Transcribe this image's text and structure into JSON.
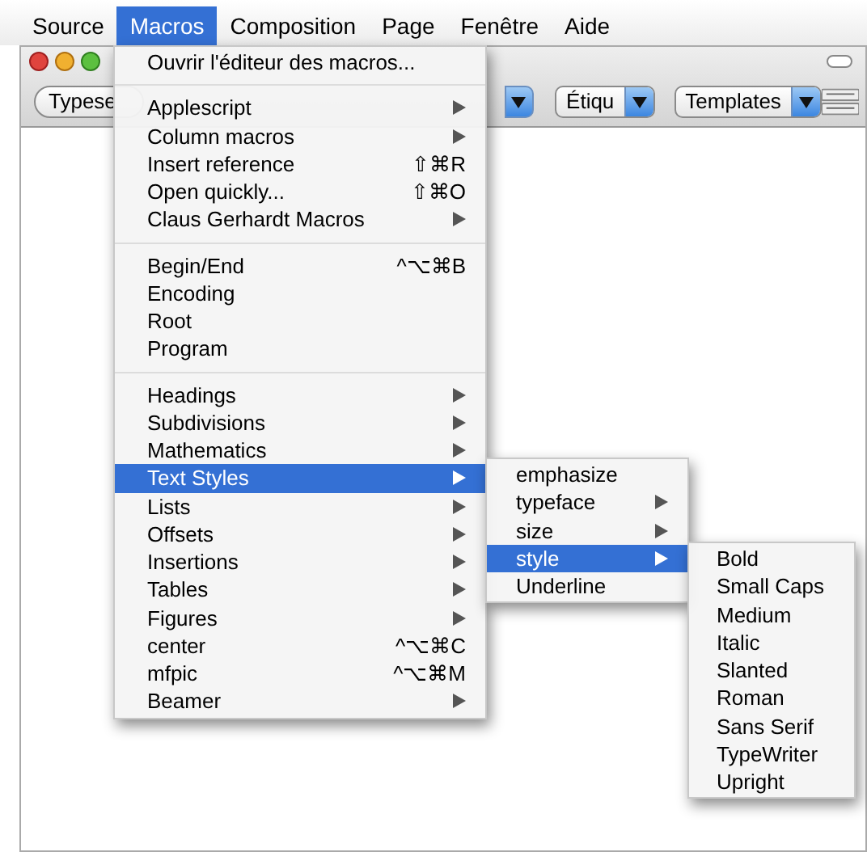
{
  "menubar": [
    {
      "label": "Source",
      "selected": false
    },
    {
      "label": "Macros",
      "selected": true
    },
    {
      "label": "Composition",
      "selected": false
    },
    {
      "label": "Page",
      "selected": false
    },
    {
      "label": "Fenêtre",
      "selected": false
    },
    {
      "label": "Aide",
      "selected": false
    }
  ],
  "toolbar": {
    "typeset_button": "Typese",
    "popups": [
      {
        "label": "Étiqu"
      },
      {
        "label": "Templates"
      }
    ]
  },
  "macros_menu": [
    {
      "kind": "item",
      "label": "Ouvrir l'éditeur des macros...",
      "selected": false
    },
    {
      "kind": "separator"
    },
    {
      "kind": "item",
      "label": "Applescript",
      "submenu": true,
      "selected": false
    },
    {
      "kind": "item",
      "label": "Column macros",
      "submenu": true,
      "selected": false
    },
    {
      "kind": "item",
      "label": "Insert reference",
      "shortcut": "⇧⌘R",
      "selected": false
    },
    {
      "kind": "item",
      "label": "Open quickly...",
      "shortcut": "⇧⌘O",
      "selected": false
    },
    {
      "kind": "item",
      "label": "Claus Gerhardt Macros",
      "submenu": true,
      "selected": false
    },
    {
      "kind": "separator"
    },
    {
      "kind": "item",
      "label": "Begin/End",
      "shortcut": "^⌥⌘B",
      "selected": false
    },
    {
      "kind": "item",
      "label": "Encoding",
      "selected": false
    },
    {
      "kind": "item",
      "label": "Root",
      "selected": false
    },
    {
      "kind": "item",
      "label": "Program",
      "selected": false
    },
    {
      "kind": "separator"
    },
    {
      "kind": "item",
      "label": "Headings",
      "submenu": true,
      "selected": false
    },
    {
      "kind": "item",
      "label": "Subdivisions",
      "submenu": true,
      "selected": false
    },
    {
      "kind": "item",
      "label": "Mathematics",
      "submenu": true,
      "selected": false
    },
    {
      "kind": "item",
      "label": "Text Styles",
      "submenu": true,
      "selected": true
    },
    {
      "kind": "item",
      "label": "Lists",
      "submenu": true,
      "selected": false
    },
    {
      "kind": "item",
      "label": "Offsets",
      "submenu": true,
      "selected": false
    },
    {
      "kind": "item",
      "label": "Insertions",
      "submenu": true,
      "selected": false
    },
    {
      "kind": "item",
      "label": "Tables",
      "submenu": true,
      "selected": false
    },
    {
      "kind": "item",
      "label": "Figures",
      "submenu": true,
      "selected": false
    },
    {
      "kind": "item",
      "label": "center",
      "shortcut": "^⌥⌘C",
      "selected": false
    },
    {
      "kind": "item",
      "label": "mfpic",
      "shortcut": "^⌥⌘M",
      "selected": false
    },
    {
      "kind": "item",
      "label": "Beamer",
      "submenu": true,
      "selected": false
    }
  ],
  "text_styles_menu": [
    {
      "kind": "item",
      "label": "emphasize",
      "selected": false
    },
    {
      "kind": "item",
      "label": "typeface",
      "submenu": true,
      "selected": false
    },
    {
      "kind": "item",
      "label": "size",
      "submenu": true,
      "selected": false
    },
    {
      "kind": "item",
      "label": "style",
      "submenu": true,
      "selected": true
    },
    {
      "kind": "item",
      "label": "Underline",
      "selected": false
    }
  ],
  "style_menu": [
    {
      "kind": "item",
      "label": "Bold",
      "selected": false
    },
    {
      "kind": "item",
      "label": "Small Caps",
      "selected": false
    },
    {
      "kind": "item",
      "label": "Medium",
      "selected": false
    },
    {
      "kind": "item",
      "label": "Italic",
      "selected": false
    },
    {
      "kind": "item",
      "label": "Slanted",
      "selected": false
    },
    {
      "kind": "item",
      "label": "Roman",
      "selected": false
    },
    {
      "kind": "item",
      "label": "Sans Serif",
      "selected": false
    },
    {
      "kind": "item",
      "label": "TypeWriter",
      "selected": false
    },
    {
      "kind": "item",
      "label": "Upright",
      "selected": false
    }
  ]
}
